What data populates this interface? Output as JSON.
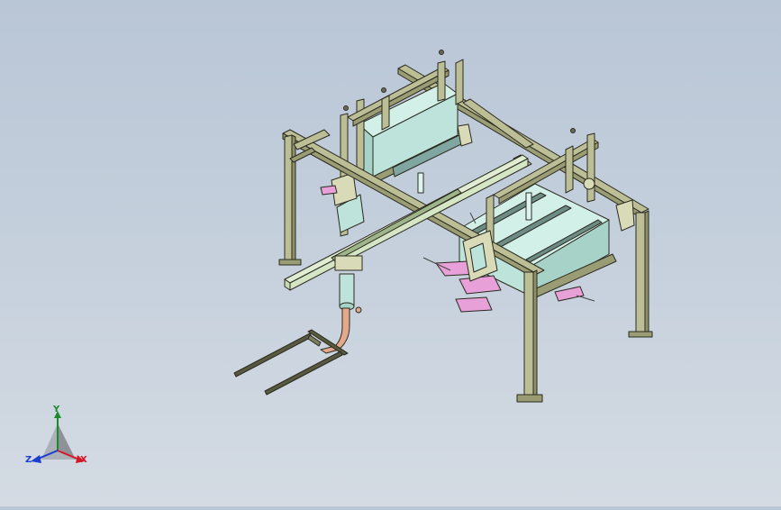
{
  "viewport": {
    "background_top": "#b9c6d6",
    "background_bottom": "#d4dbe3"
  },
  "model": {
    "frame_color": "#bcbe96",
    "frame_edge": "#2b2b20",
    "hopper_color": "#bde3da",
    "beam_color": "#d4e6c4",
    "pipe_color": "#e4a88c",
    "accent_color": "#e8a0d8"
  },
  "triad": {
    "x_label": "X",
    "y_label": "Y",
    "z_label": "Z",
    "x_color": "#d4182a",
    "y_color": "#1b8a2a",
    "z_color": "#1d3fd0"
  }
}
